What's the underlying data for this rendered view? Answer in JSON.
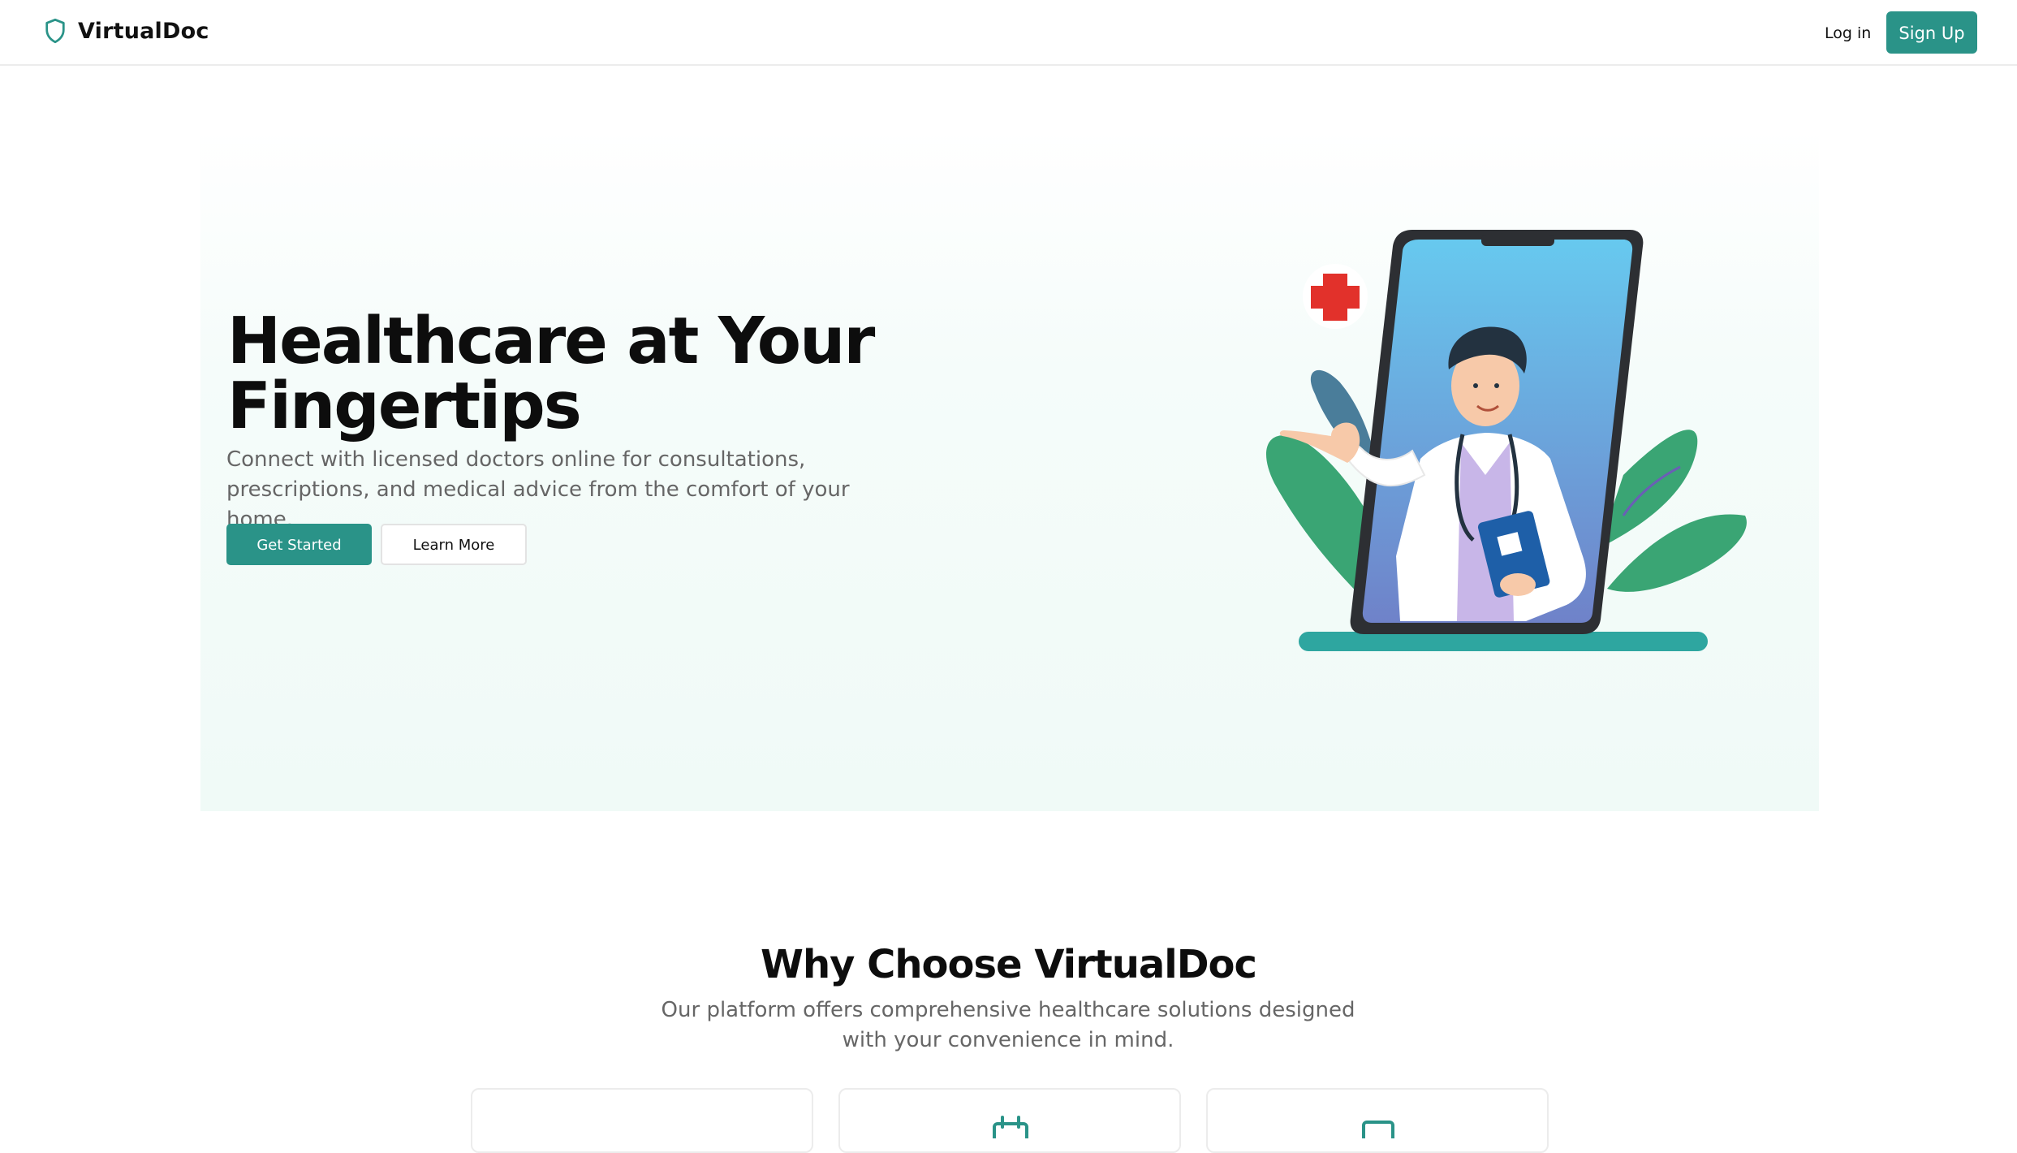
{
  "navbar": {
    "brand": "VirtualDoc",
    "brand_icon": "shield-icon",
    "login_label": "Log in",
    "signup_label": "Sign Up"
  },
  "hero": {
    "title": "Healthcare at Your Fingertips",
    "description": "Connect with licensed doctors online for consultations, prescriptions, and medical advice from the comfort of your home.",
    "primary_button": "Get Started",
    "secondary_button": "Learn More",
    "illustration": "doctor-on-phone-illustration"
  },
  "features": {
    "title": "Why Choose VirtualDoc",
    "description": "Our platform offers comprehensive healthcare solutions designed with your convenience in mind.",
    "cards": [
      {
        "icon": "none"
      },
      {
        "icon": "calendar-icon"
      },
      {
        "icon": "video-icon"
      }
    ]
  },
  "colors": {
    "accent": "#2a9388",
    "hero_bg": "#f0faf7",
    "text_muted": "#666666"
  }
}
